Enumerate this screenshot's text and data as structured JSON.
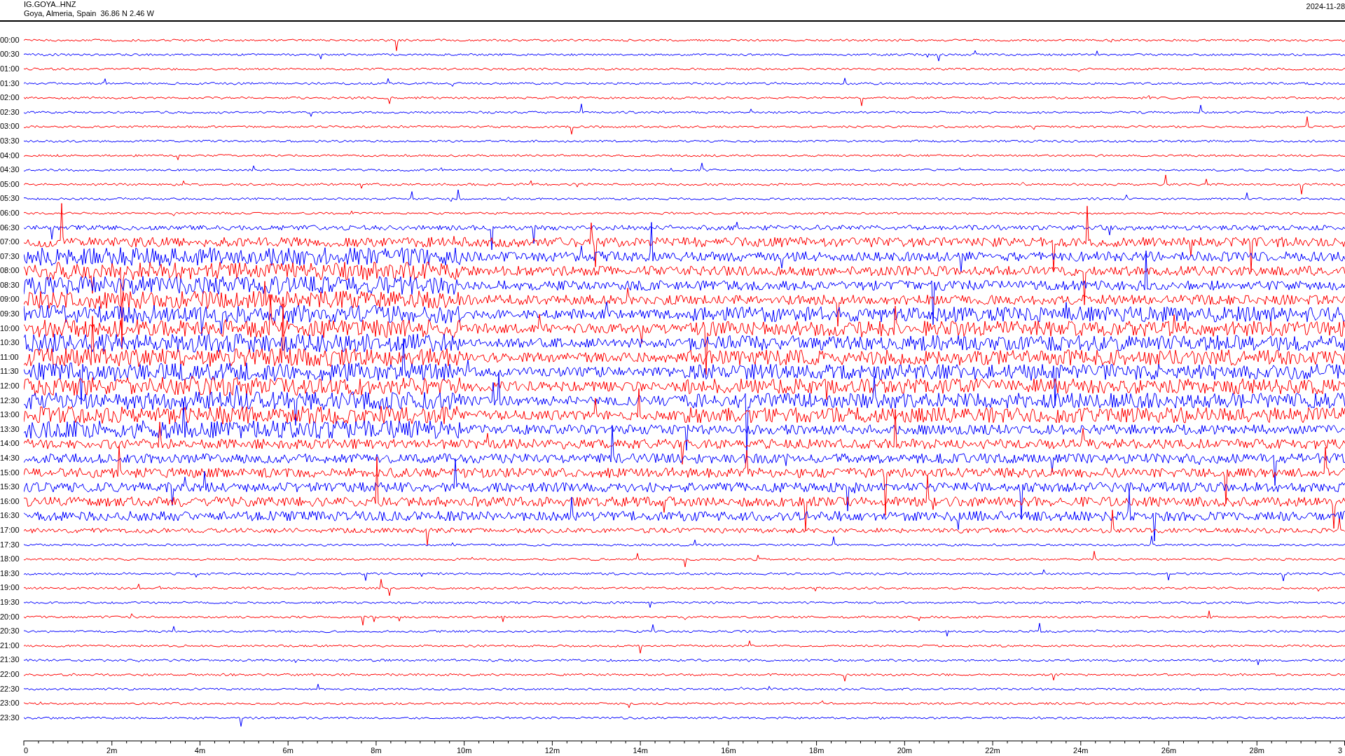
{
  "header": {
    "station": "IG.GOYA..HNZ",
    "location": "Goya, Almeria, Spain  36.86 N 2.46 W",
    "date": "2024-11-28"
  },
  "rows": [
    {
      "time": "00:00",
      "color": "#ff0000"
    },
    {
      "time": "00:30",
      "color": "#0000ff"
    },
    {
      "time": "01:00",
      "color": "#ff0000"
    },
    {
      "time": "01:30",
      "color": "#0000ff"
    },
    {
      "time": "02:00",
      "color": "#ff0000"
    },
    {
      "time": "02:30",
      "color": "#0000ff"
    },
    {
      "time": "03:00",
      "color": "#ff0000"
    },
    {
      "time": "03:30",
      "color": "#0000ff"
    },
    {
      "time": "04:00",
      "color": "#ff0000"
    },
    {
      "time": "04:30",
      "color": "#0000ff"
    },
    {
      "time": "05:00",
      "color": "#ff0000"
    },
    {
      "time": "05:30",
      "color": "#0000ff"
    },
    {
      "time": "06:00",
      "color": "#ff0000"
    },
    {
      "time": "06:30",
      "color": "#0000ff"
    },
    {
      "time": "07:00",
      "color": "#ff0000"
    },
    {
      "time": "07:30",
      "color": "#0000ff"
    },
    {
      "time": "08:00",
      "color": "#ff0000"
    },
    {
      "time": "08:30",
      "color": "#0000ff"
    },
    {
      "time": "09:00",
      "color": "#ff0000"
    },
    {
      "time": "09:30",
      "color": "#0000ff"
    },
    {
      "time": "10:00",
      "color": "#ff0000"
    },
    {
      "time": "10:30",
      "color": "#0000ff"
    },
    {
      "time": "11:00",
      "color": "#ff0000"
    },
    {
      "time": "11:30",
      "color": "#0000ff"
    },
    {
      "time": "12:00",
      "color": "#ff0000"
    },
    {
      "time": "12:30",
      "color": "#0000ff"
    },
    {
      "time": "13:00",
      "color": "#ff0000"
    },
    {
      "time": "13:30",
      "color": "#0000ff"
    },
    {
      "time": "14:00",
      "color": "#ff0000"
    },
    {
      "time": "14:30",
      "color": "#0000ff"
    },
    {
      "time": "15:00",
      "color": "#ff0000"
    },
    {
      "time": "15:30",
      "color": "#0000ff"
    },
    {
      "time": "16:00",
      "color": "#ff0000"
    },
    {
      "time": "16:30",
      "color": "#0000ff"
    },
    {
      "time": "17:00",
      "color": "#ff0000"
    },
    {
      "time": "17:30",
      "color": "#0000ff"
    },
    {
      "time": "18:00",
      "color": "#ff0000"
    },
    {
      "time": "18:30",
      "color": "#0000ff"
    },
    {
      "time": "19:00",
      "color": "#ff0000"
    },
    {
      "time": "19:30",
      "color": "#0000ff"
    },
    {
      "time": "20:00",
      "color": "#ff0000"
    },
    {
      "time": "20:30",
      "color": "#0000ff"
    },
    {
      "time": "21:00",
      "color": "#ff0000"
    },
    {
      "time": "21:30",
      "color": "#0000ff"
    },
    {
      "time": "22:00",
      "color": "#ff0000"
    },
    {
      "time": "22:30",
      "color": "#0000ff"
    },
    {
      "time": "23:00",
      "color": "#ff0000"
    },
    {
      "time": "23:30",
      "color": "#0000ff"
    }
  ],
  "x_axis": {
    "labels": [
      "0",
      "2m",
      "4m",
      "6m",
      "8m",
      "10m",
      "12m",
      "14m",
      "16m",
      "18m",
      "20m",
      "22m",
      "24m",
      "26m",
      "28m",
      "3"
    ]
  }
}
